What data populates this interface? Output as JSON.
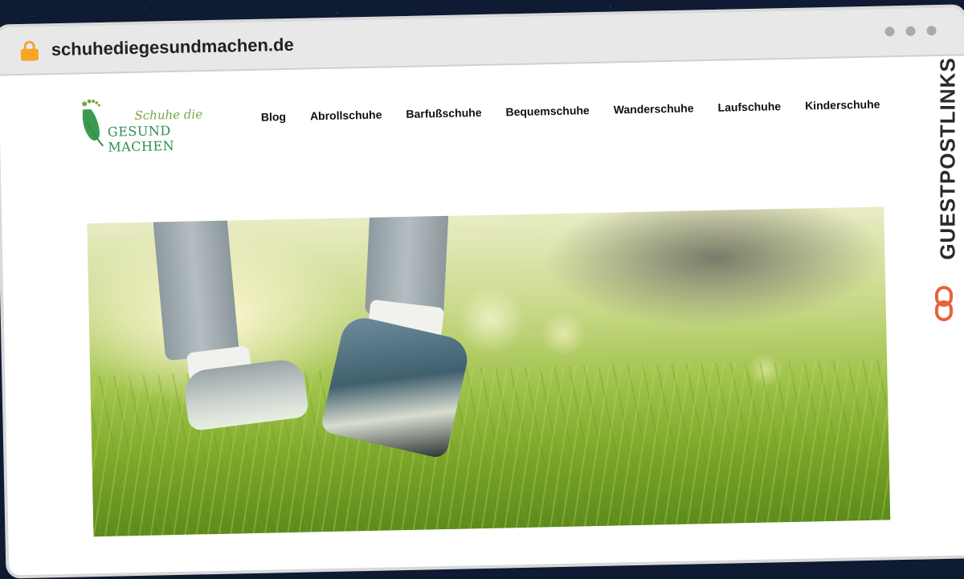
{
  "browser": {
    "url": "schuhediegesundmachen.de",
    "lock_icon": "lock-icon",
    "window_controls": [
      "dot",
      "dot",
      "dot"
    ]
  },
  "site": {
    "logo": {
      "icon": "foot-leaf-icon",
      "line1": "Schuhe die",
      "line2": "GESUND MACHEN",
      "colors": {
        "green": "#2f8f4a",
        "light_green": "#7aa83c"
      }
    },
    "nav": [
      {
        "label": "Blog"
      },
      {
        "label": "Abrollschuhe"
      },
      {
        "label": "Barfußschuhe"
      },
      {
        "label": "Bequemschuhe"
      },
      {
        "label": "Wanderschuhe"
      },
      {
        "label": "Laufschuhe"
      },
      {
        "label": "Kinderschuhe"
      }
    ],
    "hero": {
      "image": "hero-image-walking-shoes-grass"
    }
  },
  "watermark": {
    "text": "GUESTPOSTLINKS",
    "icon": "link-icon",
    "color": "#e8623a"
  }
}
